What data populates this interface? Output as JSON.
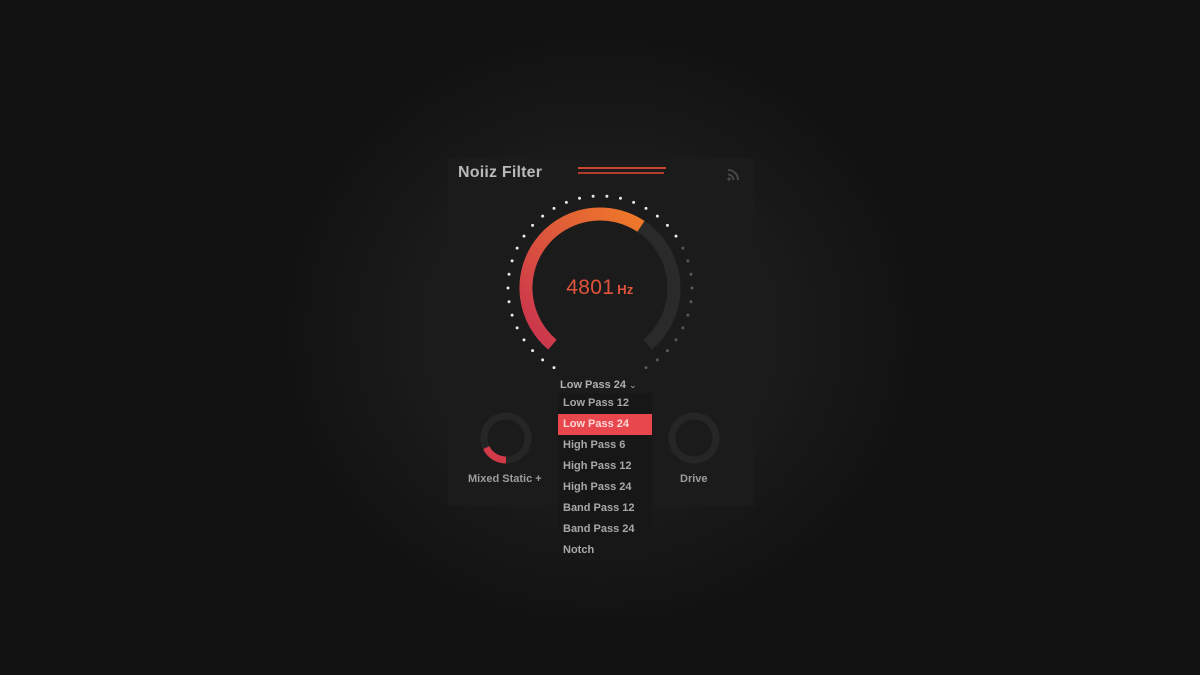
{
  "plugin": {
    "title": "Noiiz Filter",
    "accent": "#e0543c",
    "rss_icon": "rss-icon"
  },
  "main_knob": {
    "value": "4801",
    "unit": "Hz",
    "gradient_start": "#c8314f",
    "gradient_end": "#f07a28",
    "level": 0.62
  },
  "filter_type": {
    "selected_label": "Low Pass 24",
    "chevron_icon": "chevron-down-icon",
    "options": [
      "Low Pass 12",
      "Low Pass 24",
      "High Pass 6",
      "High Pass 12",
      "High Pass 24",
      "Band Pass 12",
      "Band Pass 24",
      "Notch"
    ],
    "selected_index": 1,
    "highlight": "#e8474e"
  },
  "knobs": [
    {
      "label": "Mixed Static +",
      "level": 0.35,
      "color": "#d13a48"
    },
    {
      "label": "Drive",
      "level": 0,
      "color": "#d13a48"
    }
  ]
}
